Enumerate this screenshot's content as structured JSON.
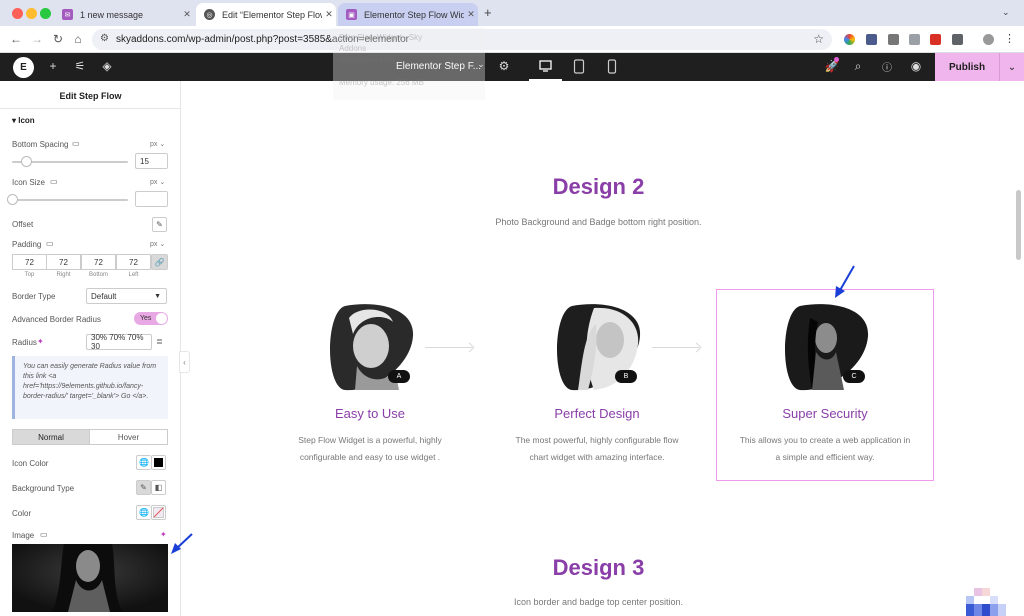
{
  "browser": {
    "tabs": [
      {
        "label": "1 new message",
        "color": "#8a3ea8"
      },
      {
        "label": "Edit “Elementor Step Flow Wi",
        "color": "#333333"
      },
      {
        "label": "Elementor Step Flow Widget",
        "color": "#8a3ea8"
      }
    ],
    "new_tab": "+",
    "url": "skyaddons.com/wp-admin/post.php?post=3585&action=elementor"
  },
  "topbar": {
    "logo": "E",
    "document_title": "Elementor Step F...",
    "publish_label": "Publish"
  },
  "ghost_dropdown": {
    "line1": "Step Flow Widget - Sky",
    "line2": "Addons",
    "line3": "skyaddons.com",
    "line4": "Memory usage: 256 MB"
  },
  "panel": {
    "title": "Edit Step Flow",
    "section": "Icon",
    "bottom_spacing": {
      "label": "Bottom Spacing",
      "unit": "px",
      "value": "15",
      "level": 0.12
    },
    "icon_size": {
      "label": "Icon Size",
      "unit": "px",
      "value": "",
      "level": 0.0
    },
    "offset": {
      "label": "Offset"
    },
    "padding": {
      "label": "Padding",
      "unit": "px",
      "values": [
        "72",
        "72",
        "72",
        "72"
      ],
      "sides": [
        "Top",
        "Right",
        "Bottom",
        "Left"
      ]
    },
    "border_type": {
      "label": "Border Type",
      "value": "Default"
    },
    "advanced_radius": {
      "label": "Advanced Border Radius",
      "toggle": "Yes"
    },
    "radius": {
      "label": "Radius",
      "value": "30% 70% 70% 30"
    },
    "notice": "You can easily generate Radius value from this link <a href='https://9elements.github.io/fancy-border-radius/' target='_blank'> Go </a>.",
    "tabs": [
      "Normal",
      "Hover"
    ],
    "icon_color": {
      "label": "Icon Color"
    },
    "background_type": {
      "label": "Background Type"
    },
    "color": {
      "label": "Color"
    },
    "image": {
      "label": "Image"
    }
  },
  "canvas": {
    "design2": {
      "title": "Design 2",
      "subtitle": "Photo Background and Badge bottom right position."
    },
    "steps": [
      {
        "title": "Easy to Use",
        "badge": "A",
        "desc1": "Step Flow Widget is a powerful, highly",
        "desc2": "configurable and easy to use widget ."
      },
      {
        "title": "Perfect Design",
        "badge": "B",
        "desc1": "The most powerful, highly configurable flow",
        "desc2": "chart widget with amazing interface."
      },
      {
        "title": "Super Security",
        "badge": "C",
        "desc1": "This allows you to create a web application in",
        "desc2": "a simple and efficient way."
      }
    ],
    "design3": {
      "title": "Design 3",
      "subtitle": "Icon border and badge top center position."
    }
  },
  "colors": {
    "accent": "#8a3ea8",
    "publish": "#f0b5ec",
    "selection": "#ef9aea",
    "annotation_arrow": "#1a3fd6"
  }
}
